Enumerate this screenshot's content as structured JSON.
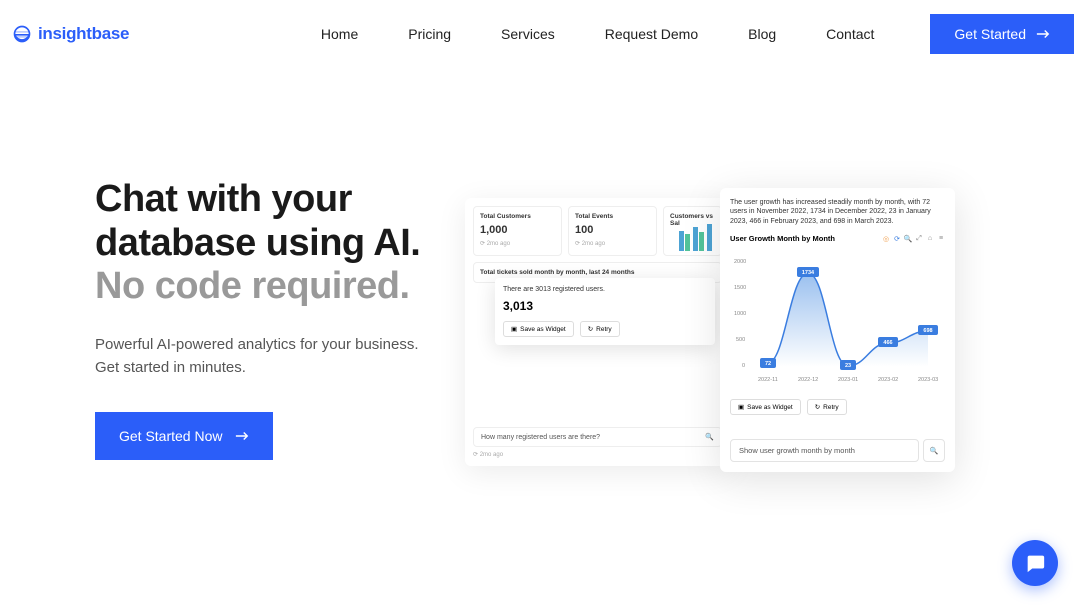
{
  "brand": {
    "name": "insightbase"
  },
  "nav": {
    "items": [
      "Home",
      "Pricing",
      "Services",
      "Request Demo",
      "Blog",
      "Contact"
    ],
    "cta": "Get Started"
  },
  "hero": {
    "title_l1": "Chat with your",
    "title_l2": "database using AI.",
    "title_sub": "No code required.",
    "para_l1": "Powerful AI-powered analytics for your business.",
    "para_l2": "Get started in minutes.",
    "cta": "Get Started Now"
  },
  "dash": {
    "card1": {
      "label": "Total Customers",
      "value": "1,000",
      "meta": "2mo ago"
    },
    "card2": {
      "label": "Total Events",
      "value": "100",
      "meta": "2mo ago"
    },
    "card3": {
      "label": "Customers vs Sal"
    },
    "wide": {
      "label": "Total tickets sold month by month, last 24 months"
    },
    "modal": {
      "answer": "There are 3013 registered users.",
      "big": "3,013",
      "save": "Save as Widget",
      "retry": "Retry"
    },
    "input": "How many registered users are there?",
    "footer": "2mo ago"
  },
  "chart": {
    "desc": "The user growth has increased steadily month by month, with 72 users in November 2022, 1734 in December 2022, 23 in January 2023, 466 in February 2023, and 698 in March 2023.",
    "title": "User Growth Month by Month",
    "save": "Save as Widget",
    "retry": "Retry",
    "input": "Show user growth month by month"
  },
  "chart_data": {
    "type": "line",
    "title": "User Growth Month by Month",
    "xlabel": "",
    "ylabel": "",
    "categories": [
      "2022-11",
      "2022-12",
      "2023-01",
      "2023-02",
      "2023-03"
    ],
    "values": [
      72,
      1734,
      23,
      466,
      698
    ],
    "y_ticks": [
      0,
      500,
      1000,
      1500,
      2000
    ],
    "ylim": [
      0,
      2000
    ]
  }
}
